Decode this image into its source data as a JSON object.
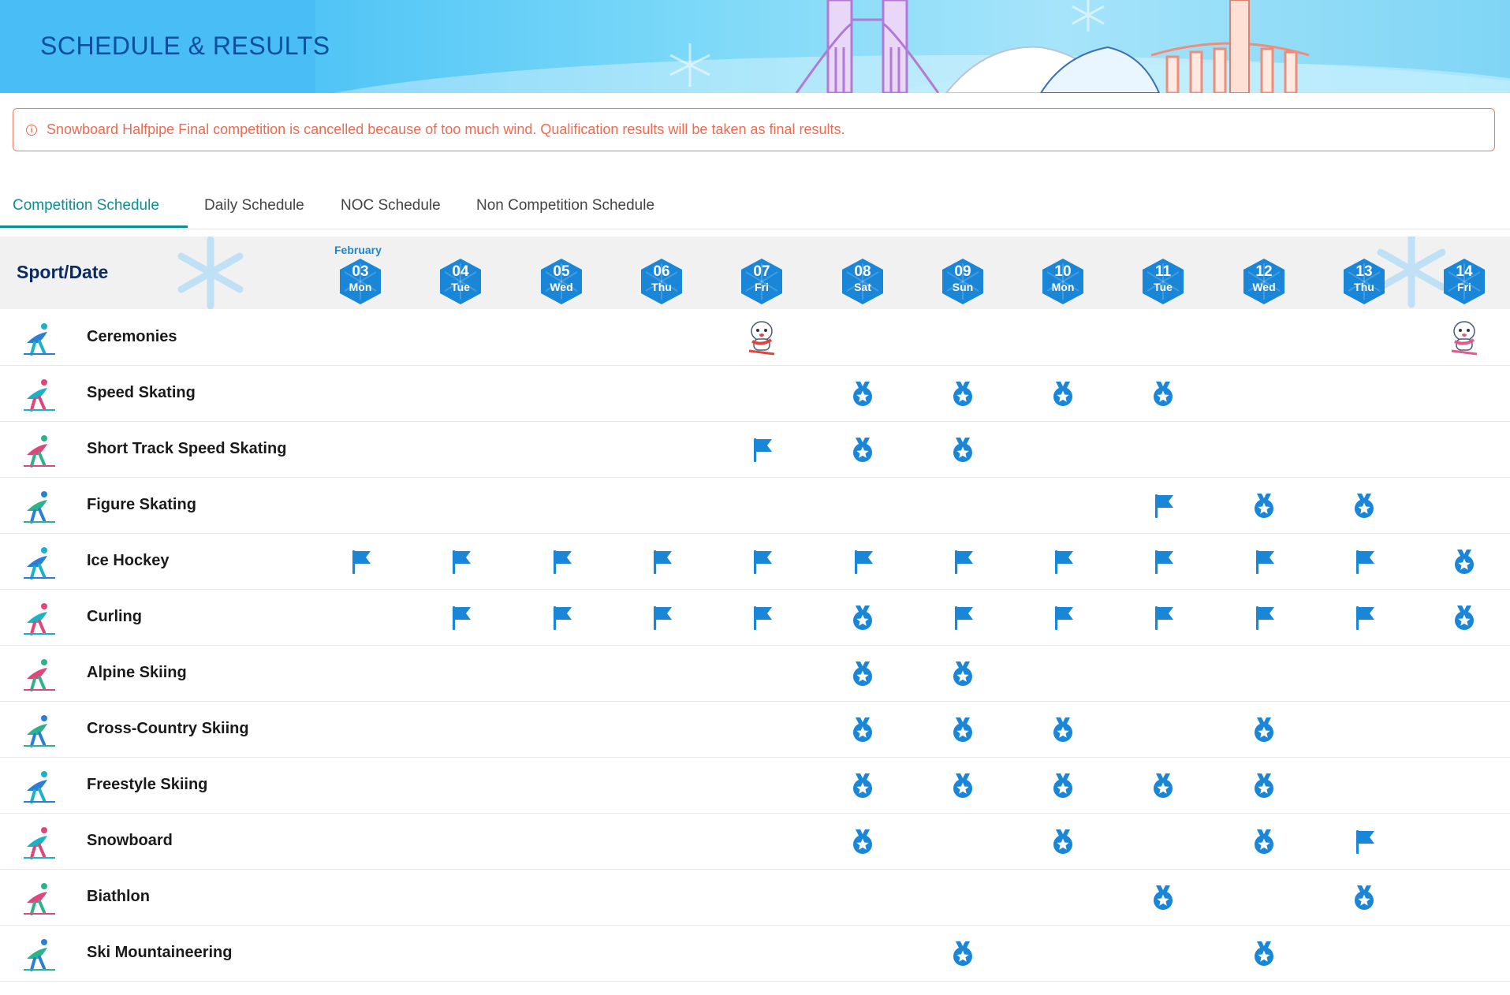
{
  "banner": {
    "title": "SCHEDULE & RESULTS"
  },
  "alert": {
    "text": "Snowboard Halfpipe Final competition is cancelled because of too much wind. Qualification results will be taken as final results."
  },
  "tabs": [
    {
      "label": "Competition Schedule",
      "active": true
    },
    {
      "label": "Daily Schedule",
      "active": false
    },
    {
      "label": "NOC Schedule",
      "active": false
    },
    {
      "label": "Non Competition Schedule",
      "active": false
    }
  ],
  "schedule": {
    "header_label": "Sport/Date",
    "month": "February",
    "dates": [
      {
        "num": "03",
        "day": "Mon"
      },
      {
        "num": "04",
        "day": "Tue"
      },
      {
        "num": "05",
        "day": "Wed"
      },
      {
        "num": "06",
        "day": "Thu"
      },
      {
        "num": "07",
        "day": "Fri"
      },
      {
        "num": "08",
        "day": "Sat"
      },
      {
        "num": "09",
        "day": "Sun"
      },
      {
        "num": "10",
        "day": "Mon"
      },
      {
        "num": "11",
        "day": "Tue"
      },
      {
        "num": "12",
        "day": "Wed"
      },
      {
        "num": "13",
        "day": "Thu"
      },
      {
        "num": "14",
        "day": "Fri"
      }
    ],
    "legend_icons": {
      "F": "flag-icon",
      "M": "medal-icon",
      "O": "opening-ceremony-mascot-icon",
      "C": "closing-ceremony-mascot-icon"
    },
    "colors": {
      "accent": "#1a86d8",
      "tab_active": "#0d8f8f",
      "alert": "#ee6a50",
      "header_bg": "#f1f1f1"
    },
    "sports": [
      {
        "name": "Ceremonies",
        "icon": "ceremonies-logo-icon",
        "cells": [
          "",
          "",
          "",
          "",
          "O",
          "",
          "",
          "",
          "",
          "",
          "",
          "C"
        ]
      },
      {
        "name": "Speed Skating",
        "icon": "speed-skating-icon",
        "cells": [
          "",
          "",
          "",
          "",
          "",
          "M",
          "M",
          "M",
          "M",
          "",
          "",
          ""
        ]
      },
      {
        "name": "Short Track Speed Skating",
        "icon": "short-track-icon",
        "cells": [
          "",
          "",
          "",
          "",
          "F",
          "M",
          "M",
          "",
          "",
          "",
          "",
          ""
        ]
      },
      {
        "name": "Figure Skating",
        "icon": "figure-skating-icon",
        "cells": [
          "",
          "",
          "",
          "",
          "",
          "",
          "",
          "",
          "F",
          "M",
          "M",
          ""
        ]
      },
      {
        "name": "Ice Hockey",
        "icon": "ice-hockey-icon",
        "cells": [
          "F",
          "F",
          "F",
          "F",
          "F",
          "F",
          "F",
          "F",
          "F",
          "F",
          "F",
          "M"
        ]
      },
      {
        "name": "Curling",
        "icon": "curling-icon",
        "cells": [
          "",
          "F",
          "F",
          "F",
          "F",
          "M",
          "F",
          "F",
          "F",
          "F",
          "F",
          "M"
        ]
      },
      {
        "name": "Alpine Skiing",
        "icon": "alpine-skiing-icon",
        "cells": [
          "",
          "",
          "",
          "",
          "",
          "M",
          "M",
          "",
          "",
          "",
          "",
          ""
        ]
      },
      {
        "name": "Cross-Country Skiing",
        "icon": "cross-country-skiing-icon",
        "cells": [
          "",
          "",
          "",
          "",
          "",
          "M",
          "M",
          "M",
          "",
          "M",
          "",
          ""
        ]
      },
      {
        "name": "Freestyle Skiing",
        "icon": "freestyle-skiing-icon",
        "cells": [
          "",
          "",
          "",
          "",
          "",
          "M",
          "M",
          "M",
          "M",
          "M",
          "",
          ""
        ]
      },
      {
        "name": "Snowboard",
        "icon": "snowboard-icon",
        "cells": [
          "",
          "",
          "",
          "",
          "",
          "M",
          "",
          "M",
          "",
          "M",
          "F",
          ""
        ]
      },
      {
        "name": "Biathlon",
        "icon": "biathlon-icon",
        "cells": [
          "",
          "",
          "",
          "",
          "",
          "",
          "",
          "",
          "M",
          "",
          "M",
          ""
        ]
      },
      {
        "name": "Ski Mountaineering",
        "icon": "ski-mountaineering-icon",
        "cells": [
          "",
          "",
          "",
          "",
          "",
          "",
          "M",
          "",
          "",
          "M",
          "",
          ""
        ]
      }
    ]
  }
}
